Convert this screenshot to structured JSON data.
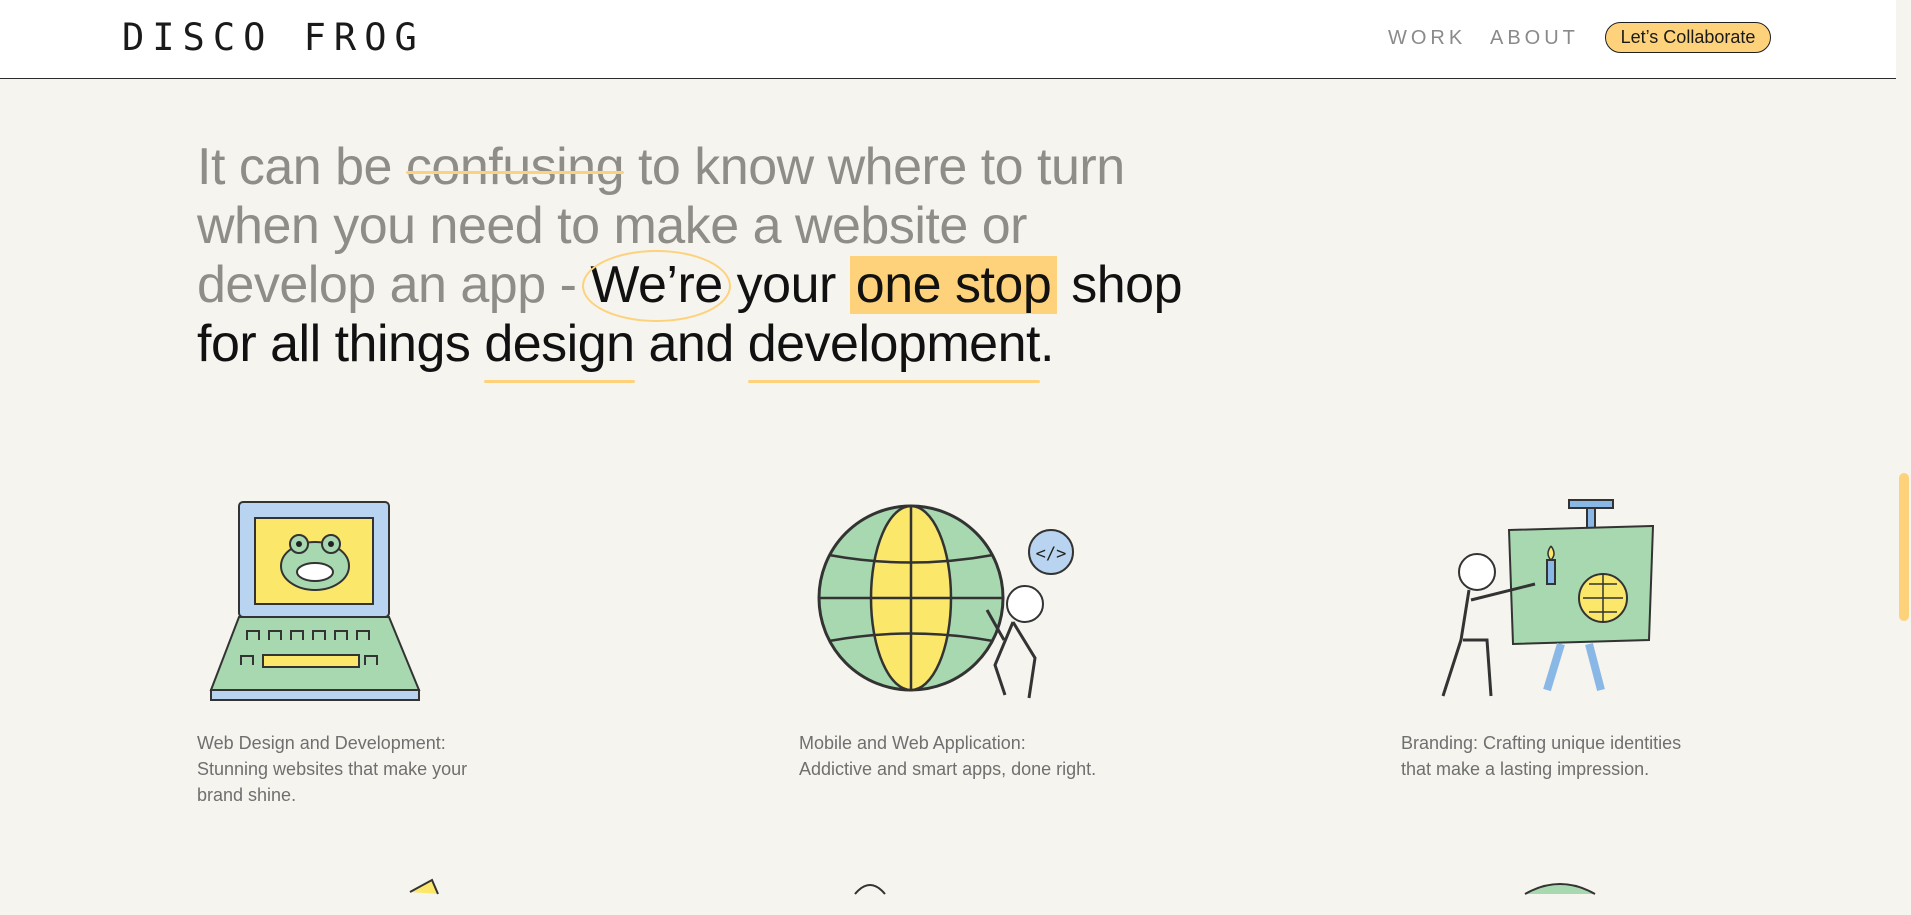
{
  "header": {
    "logo": "DISCO FROG",
    "nav": {
      "work": "WORK",
      "about": "ABOUT"
    },
    "cta": "Let’s Collaborate"
  },
  "hero": {
    "p1": "It can be ",
    "strike": "confusing",
    "p2": " to know where to turn when you need to make a website or develop an app - ",
    "circled": "We’re",
    "p3": " your ",
    "highlight": "one stop",
    "p4": " shop for all things ",
    "underline1": "design",
    "p5": " and ",
    "underline2": "development",
    "p6": "."
  },
  "services": [
    {
      "text": "Web Design and Development: Stunning websites that make your brand shine.",
      "icon": "laptop-frog-icon"
    },
    {
      "text": "Mobile and Web Application: Addictive and smart apps, done right.",
      "icon": "globe-code-icon"
    },
    {
      "text": "Branding: Crafting unique identities that make a lasting impression.",
      "icon": "easel-painter-icon"
    }
  ],
  "colors": {
    "accent": "#fdd27a",
    "background": "#f5f4ef",
    "green": "#a8d8b0",
    "blue": "#8ab8e6"
  }
}
